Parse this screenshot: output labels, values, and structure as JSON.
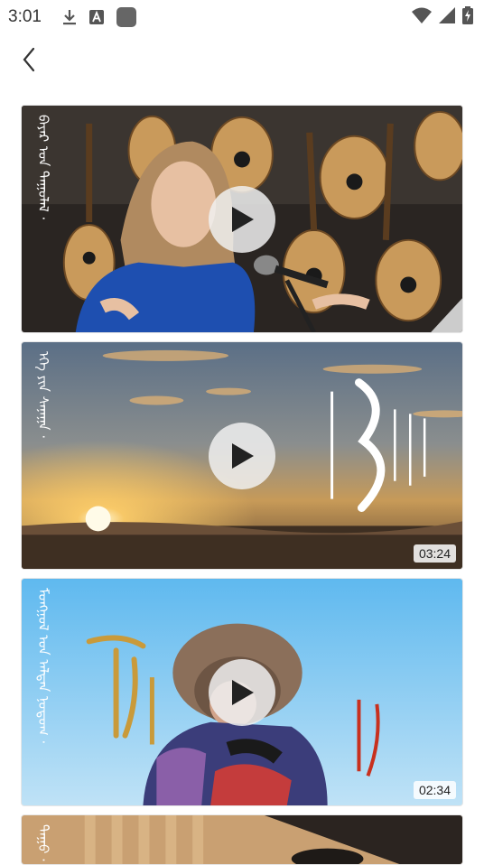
{
  "status_bar": {
    "time": "3:01",
    "icons_left": [
      "download-icon",
      "a-keyboard-icon",
      "app-square-icon"
    ],
    "icons_right": [
      "wifi-icon",
      "signal-icon",
      "battery-charging-icon"
    ]
  },
  "nav": {
    "back_icon": "chevron-left-icon"
  },
  "videos": [
    {
      "title": "ᠪᠠᠶᠠᠷ ᠤᠨ ᠳᠠᠭᠤᠯᠠᠯ ·",
      "duration": "",
      "scene": "singer"
    },
    {
      "title": "ᠡᠬᠡ ᠶᠢᠨ ᠰᠠᠨᠠᠭᠠ ·",
      "duration": "03:24",
      "scene": "sunset"
    },
    {
      "title": "ᠮᠣᠩᠭᠣᠯ ᠤᠨ ᠠᠯᠲᠠᠨ ᠨᠤᠲᠤᠭ ·",
      "duration": "02:34",
      "scene": "fur-hat"
    },
    {
      "title": "ᠳᠠᠭᠤ ·",
      "duration": "",
      "scene": "room"
    }
  ],
  "colors": {
    "play_bg": "#f0f0f0",
    "play_icon": "#222222",
    "duration_bg": "#ffffff"
  }
}
